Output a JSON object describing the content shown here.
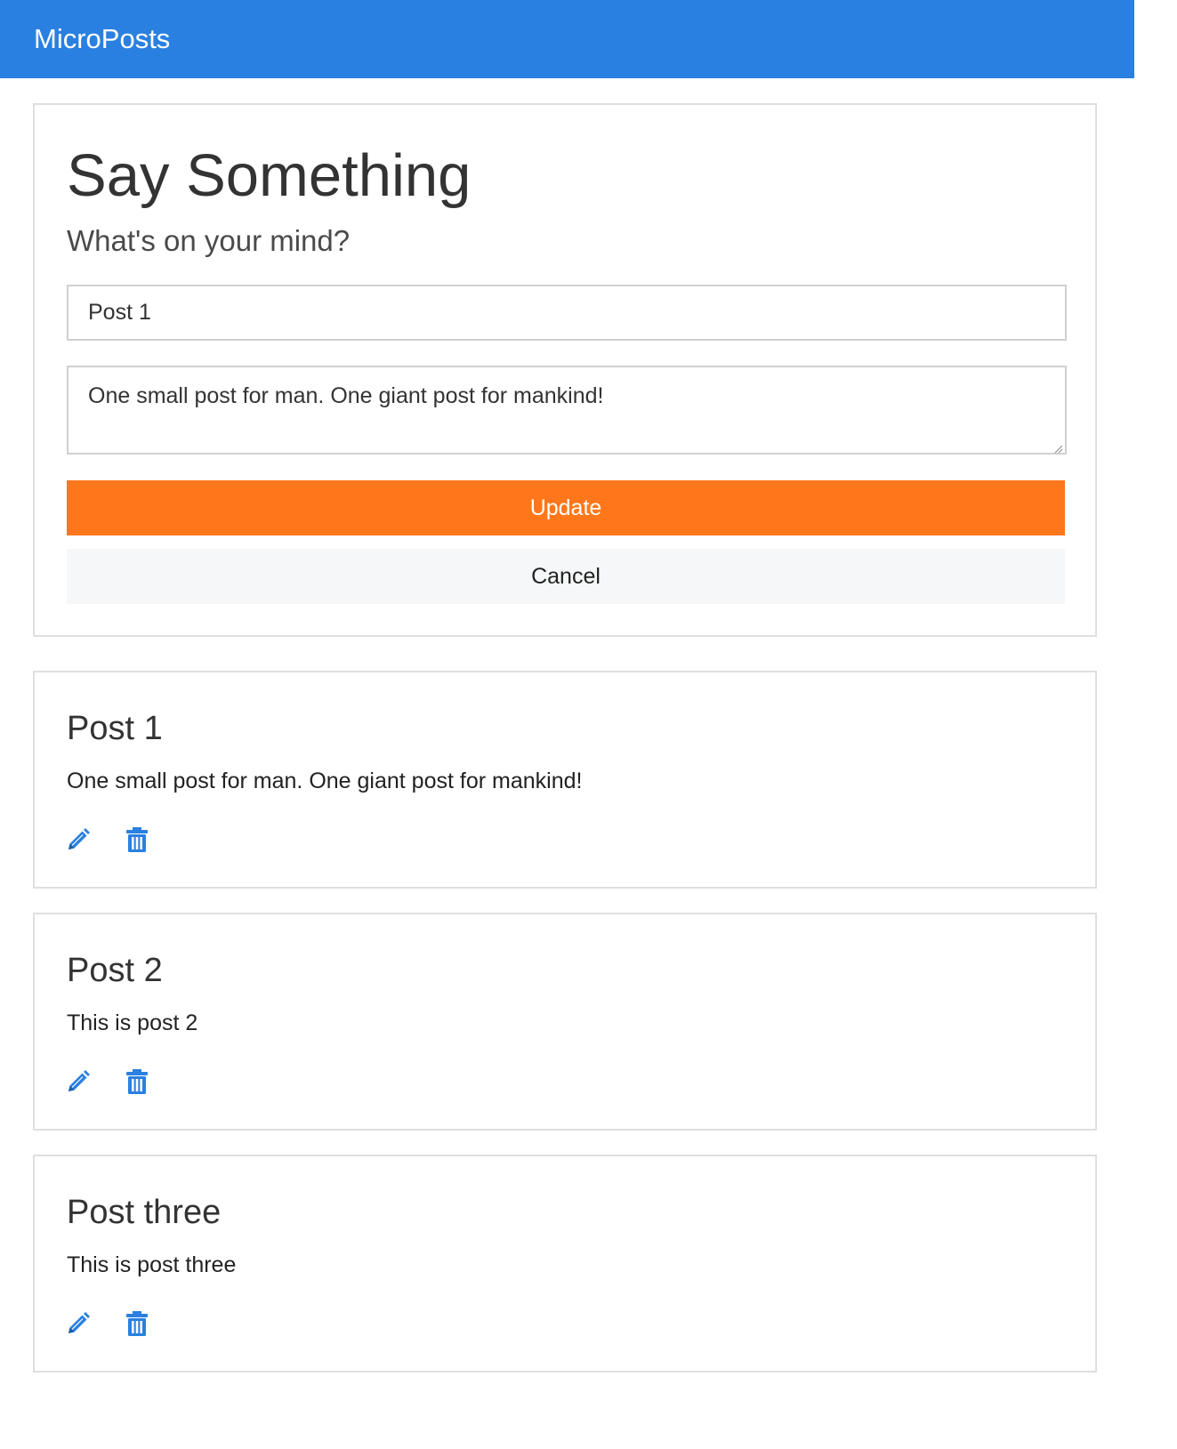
{
  "navbar": {
    "brand": "MicroPosts",
    "color": "#2A80E0"
  },
  "composer": {
    "heading": "Say Something",
    "lead": "What's on your mind?",
    "title_value": "Post 1",
    "body_value": "One small post for man. One giant post for mankind!",
    "update_label": "Update",
    "cancel_label": "Cancel",
    "update_color": "#FF771A"
  },
  "posts": [
    {
      "title": "Post 1",
      "body": "One small post for man. One giant post for mankind!",
      "edit_icon": "pencil-icon",
      "delete_icon": "trash-icon"
    },
    {
      "title": "Post 2",
      "body": "This is post 2",
      "edit_icon": "pencil-icon",
      "delete_icon": "trash-icon"
    },
    {
      "title": "Post three",
      "body": "This is post three",
      "edit_icon": "pencil-icon",
      "delete_icon": "trash-icon"
    }
  ],
  "icon_color": "#2A80E0"
}
